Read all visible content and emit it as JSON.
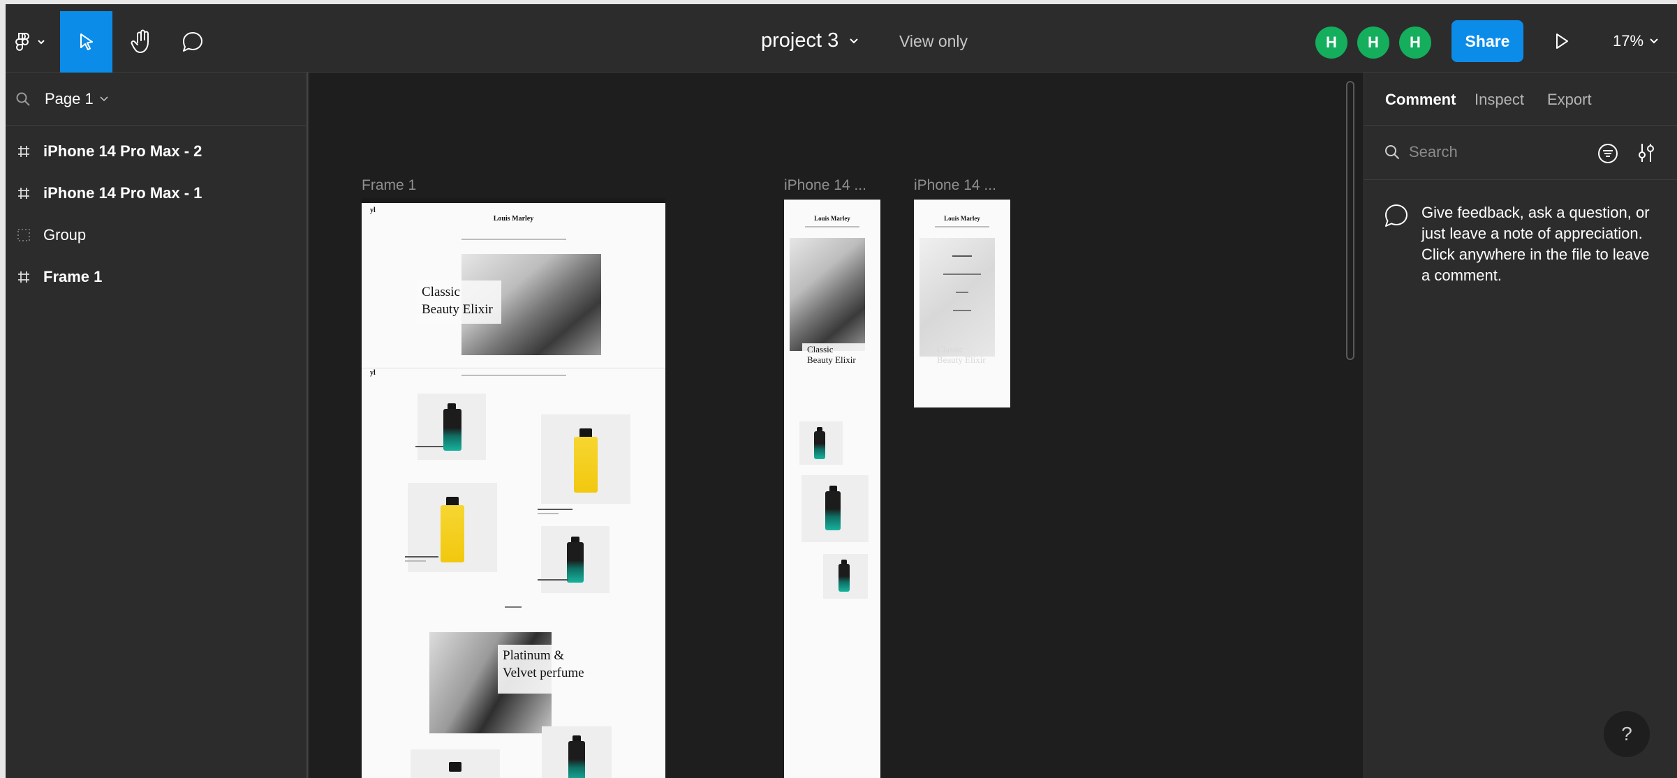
{
  "toolbar": {
    "tools": [
      {
        "name": "main-menu",
        "icon": "figma-logo-icon"
      },
      {
        "name": "move-tool",
        "icon": "cursor-icon",
        "active": true
      },
      {
        "name": "hand-tool",
        "icon": "hand-icon"
      },
      {
        "name": "comment-tool",
        "icon": "comment-icon"
      }
    ],
    "file_title": "project 3",
    "access_mode": "View only",
    "avatars": [
      "H",
      "H",
      "H"
    ],
    "avatar_color": "#14ae5c",
    "share_label": "Share",
    "zoom_level": "17%",
    "accent_color": "#0c8ce9"
  },
  "left_panel": {
    "page_name": "Page 1",
    "layers": [
      {
        "label": "iPhone 14 Pro Max - 2",
        "icon": "frame-hash-icon"
      },
      {
        "label": "iPhone 14 Pro Max - 1",
        "icon": "frame-hash-icon"
      },
      {
        "label": "Group",
        "icon": "group-dashed-icon"
      },
      {
        "label": "Frame 1",
        "icon": "frame-hash-icon"
      }
    ]
  },
  "canvas": {
    "frame_labels": [
      "Frame 1",
      "iPhone 14 ...",
      "iPhone 14 ..."
    ],
    "frame1": {
      "brand": "Louis Marley",
      "logo": "yl",
      "hero_title_line1": "Classic",
      "hero_title_line2": "Beauty Elixir",
      "feature_title_line1": "Platinum &",
      "feature_title_line2": "Velvet perfume"
    },
    "frame2": {
      "brand": "Louis Marley",
      "hero_title_line1": "Classic",
      "hero_title_line2": "Beauty Elixir"
    },
    "frame3": {
      "brand": "Louis Marley",
      "ghost_title_line1": "Classic",
      "ghost_title_line2": "Beauty Elixir"
    }
  },
  "right_panel": {
    "tabs": [
      "Comment",
      "Inspect",
      "Export"
    ],
    "active_tab": "Comment",
    "search_placeholder": "Search",
    "hint": "Give feedback, ask a question, or just leave a note of appreciation. Click anywhere in the file to leave a comment.",
    "help_label": "?"
  }
}
